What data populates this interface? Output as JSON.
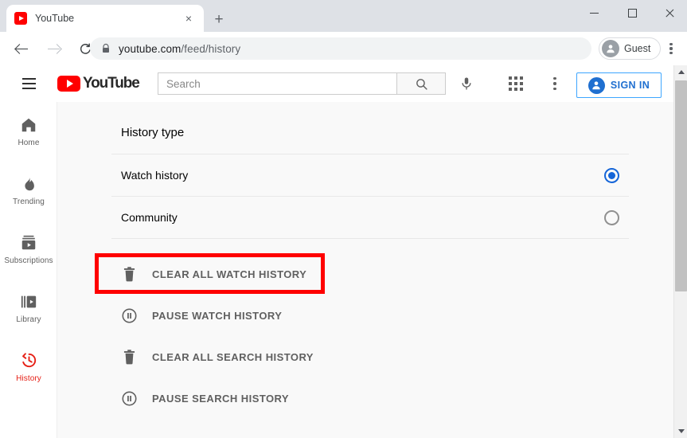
{
  "browser": {
    "tab": {
      "title": "YouTube",
      "favicon": "youtube-favicon",
      "close_label": "×"
    },
    "new_tab_label": "+",
    "window_controls": {
      "minimize": "minimize",
      "maximize": "maximize",
      "close": "close"
    },
    "nav": {
      "back": "back-arrow",
      "forward": "forward-arrow",
      "reload": "reload"
    },
    "address": {
      "lock": "secure-lock",
      "url_domain": "youtube.com",
      "url_path": "/feed/history",
      "full_url": "youtube.com/feed/history"
    },
    "profile": {
      "label": "Guest"
    },
    "menu": "chrome-kebab"
  },
  "masthead": {
    "menu_icon": "hamburger-menu",
    "logo_text": "YouTube",
    "search": {
      "value": "",
      "placeholder": "Search",
      "button_icon": "search-icon"
    },
    "mic_icon": "microphone-icon",
    "apps_icon": "apps-grid-icon",
    "kebab_icon": "more-vertical-icon",
    "sign_in_label": "SIGN IN"
  },
  "sidebar": {
    "items": [
      {
        "label": "Home",
        "icon": "home-icon",
        "active": false
      },
      {
        "label": "Trending",
        "icon": "trending-flame-icon",
        "active": false
      },
      {
        "label": "Subscriptions",
        "icon": "subscriptions-icon",
        "active": false
      },
      {
        "label": "Library",
        "icon": "library-icon",
        "active": false
      },
      {
        "label": "History",
        "icon": "history-clock-icon",
        "active": true
      }
    ],
    "active_color": "#e62117"
  },
  "main": {
    "section_title": "History type",
    "radio_options": [
      {
        "label": "Watch history",
        "selected": true
      },
      {
        "label": "Community",
        "selected": false
      }
    ],
    "actions": [
      {
        "label": "CLEAR ALL WATCH HISTORY",
        "icon": "trash-icon",
        "highlighted": true
      },
      {
        "label": "PAUSE WATCH HISTORY",
        "icon": "pause-circle-icon",
        "highlighted": false
      },
      {
        "label": "CLEAR ALL SEARCH HISTORY",
        "icon": "trash-icon",
        "highlighted": false
      },
      {
        "label": "PAUSE SEARCH HISTORY",
        "icon": "pause-circle-icon",
        "highlighted": false
      }
    ],
    "highlight_color": "#ff0000",
    "radio_selected_color": "#1565d8"
  }
}
